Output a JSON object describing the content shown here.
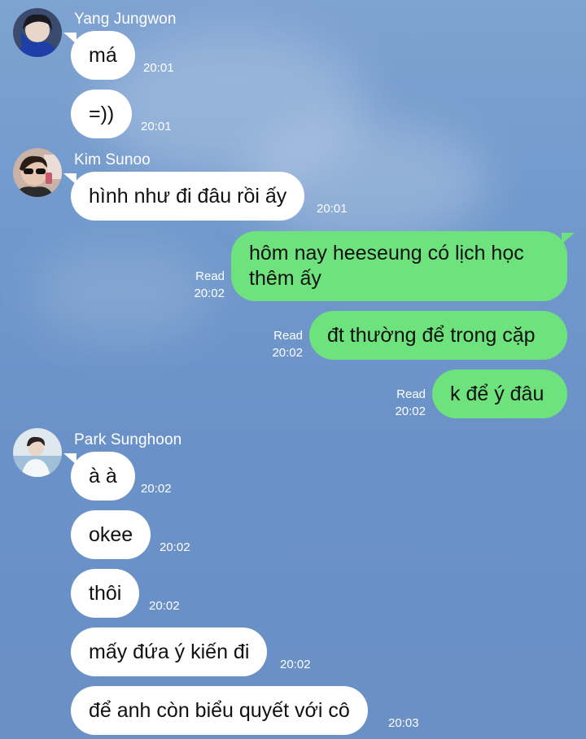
{
  "colors": {
    "background": "#7199cc",
    "incoming_bubble": "#ffffff",
    "outgoing_bubble": "#6ee27c"
  },
  "groups": [
    {
      "sender": "Yang Jungwon",
      "avatar_icon": "avatar-photo-yang-jungwon",
      "messages": [
        {
          "text": "má",
          "time": "20:01"
        },
        {
          "text": "=))",
          "time": "20:01"
        }
      ]
    },
    {
      "sender": "Kim Sunoo",
      "avatar_icon": "avatar-photo-kim-sunoo",
      "messages": [
        {
          "text": "hình như đi đâu rồi ấy",
          "time": "20:01"
        }
      ]
    },
    {
      "sender": "Park Sunghoon",
      "avatar_icon": "avatar-photo-park-sunghoon",
      "messages": [
        {
          "text": "à à",
          "time": "20:02"
        },
        {
          "text": "okee",
          "time": "20:02"
        },
        {
          "text": "thôi",
          "time": "20:02"
        },
        {
          "text": "mấy đứa ý kiến đi",
          "time": "20:02"
        },
        {
          "text": "để anh còn biểu quyết với cô",
          "time": "20:03"
        }
      ]
    }
  ],
  "outgoing": [
    {
      "text": "hôm nay heeseung có lịch học thêm ấy",
      "status": "Read",
      "time": "20:02"
    },
    {
      "text": "đt thường để trong cặp",
      "status": "Read",
      "time": "20:02"
    },
    {
      "text": "k để ý đâu",
      "status": "Read",
      "time": "20:02"
    }
  ]
}
